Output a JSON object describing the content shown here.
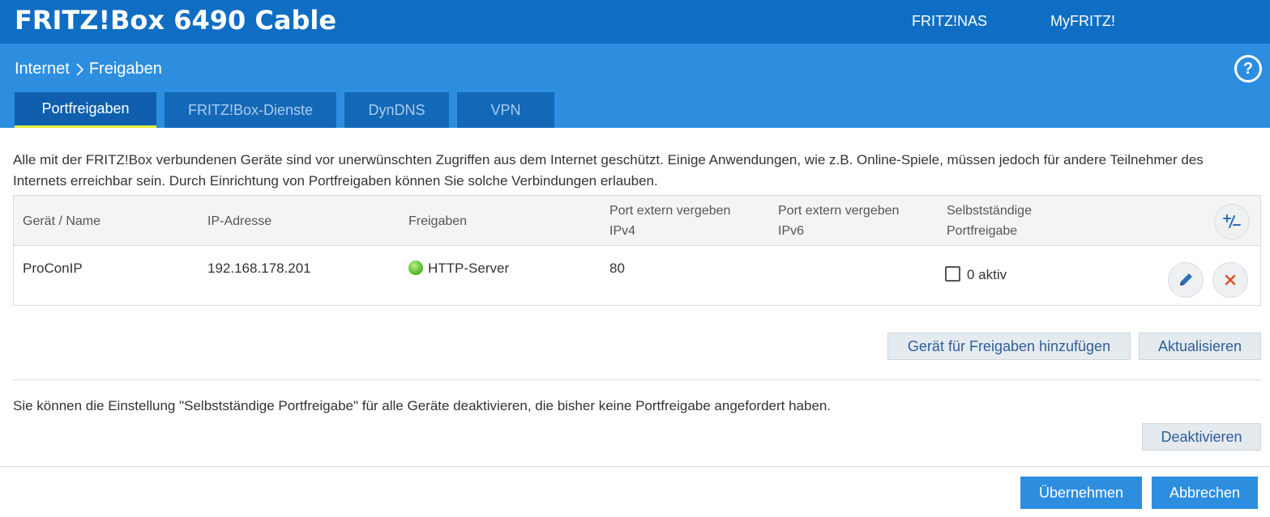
{
  "header": {
    "title": "FRITZ!Box 6490 Cable",
    "nav": [
      "FRITZ!NAS",
      "MyFRITZ!"
    ]
  },
  "breadcrumb": {
    "parent": "Internet",
    "separator": ">",
    "current": "Freigaben"
  },
  "help": {
    "icon": "help-icon",
    "label": "?"
  },
  "tabs": [
    {
      "label": "Portfreigaben",
      "active": true
    },
    {
      "label": "FRITZ!Box-Dienste",
      "active": false
    },
    {
      "label": "DynDNS",
      "active": false
    },
    {
      "label": "VPN",
      "active": false
    }
  ],
  "intro_text": "Alle mit der FRITZ!Box verbundenen Geräte sind vor unerwünschten Zugriffen aus dem Internet geschützt. Einige Anwendungen, wie z.B. Online-Spiele, müssen jedoch für andere Teilnehmer des Internets erreichbar sein. Durch Einrichtung von Portfreigaben können Sie solche Verbindungen erlauben.",
  "table": {
    "columns": [
      "Gerät / Name",
      "IP-Adresse",
      "Freigaben",
      "Port extern vergeben IPv4",
      "Port extern vergeben IPv6",
      "Selbstständige Portfreigabe"
    ],
    "rows": [
      {
        "name": "ProConIP",
        "ip": "192.168.178.201",
        "share": "HTTP-Server",
        "share_status_color": "#5cbc2d",
        "port_ipv4": "80",
        "port_ipv6": "",
        "auto_release_checked": false,
        "auto_release_label": "0 aktiv"
      }
    ]
  },
  "buttons": {
    "add_device": "Gerät für Freigaben hinzufügen",
    "refresh": "Aktualisieren",
    "deactivate": "Deaktivieren",
    "apply": "Übernehmen",
    "cancel": "Abbrechen"
  },
  "note_text": "Sie können die Einstellung \"Selbstständige Portfreigabe\" für alle Geräte deaktivieren, die bisher keine Portfreigabe angefordert haben.",
  "icons": {
    "toggle_columns": "plus-minus-icon",
    "edit": "pencil-icon",
    "delete": "close-icon"
  },
  "colors": {
    "topbar": "#0f6ec4",
    "subbar": "#2d8ee0",
    "tab_active_underline": "#e3ed3a",
    "primary_button": "#2d8ee0",
    "delete_icon": "#e0532f",
    "edit_icon": "#2d6fb8"
  }
}
